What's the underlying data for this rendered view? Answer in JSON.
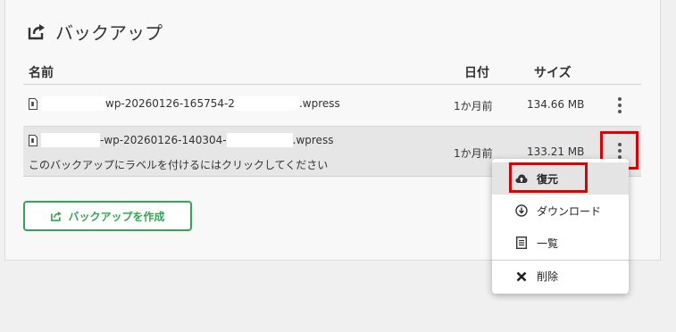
{
  "panel": {
    "title": "バックアップ",
    "title_icon": "export-icon"
  },
  "table": {
    "columns": {
      "name": "名前",
      "date": "日付",
      "size": "サイズ"
    },
    "rows": [
      {
        "name_prefix": "",
        "name_mid": "wp-20260126-165754-2",
        "name_suffix": ".wpress",
        "date": "1か月前",
        "size": "134.66 MB"
      },
      {
        "name_prefix": "",
        "name_mid": "-wp-20260126-140304-",
        "name_suffix": ".wpress",
        "date": "1か月前",
        "size": "133.21 MB",
        "label_hint": "このバックアップにラベルを付けるにはクリックしてください"
      }
    ]
  },
  "create_button": {
    "label": "バックアップを作成",
    "icon": "export-icon"
  },
  "context_menu": {
    "items": [
      {
        "label": "復元",
        "icon": "cloud-upload-icon"
      },
      {
        "label": "ダウンロード",
        "icon": "download-circle-icon"
      },
      {
        "label": "一覧",
        "icon": "list-icon"
      },
      {
        "label": "削除",
        "icon": "close-icon"
      }
    ]
  },
  "colors": {
    "accent_green": "#2fa84f",
    "highlight_red": "#e00000",
    "selected_row": "#e6e6e6"
  }
}
